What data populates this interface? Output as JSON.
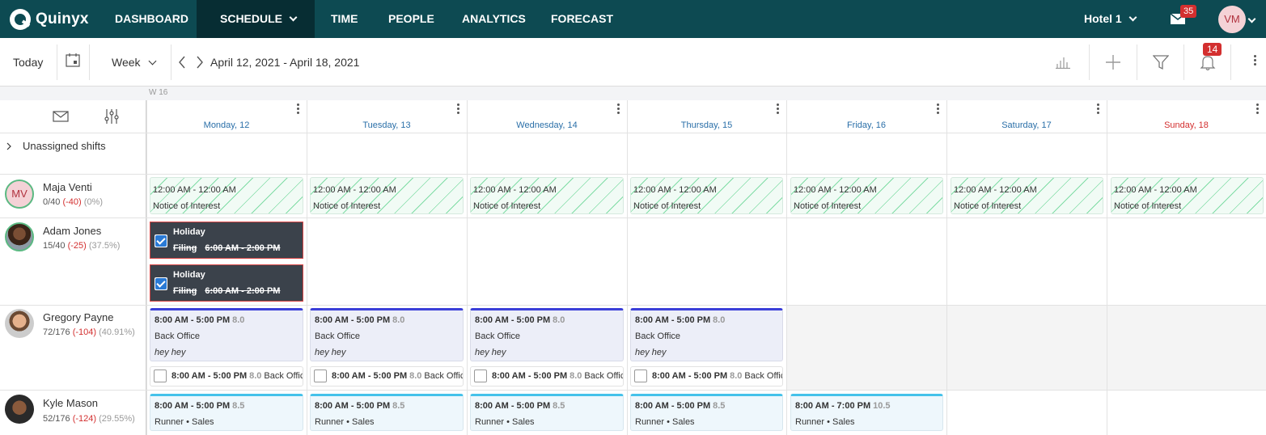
{
  "nav": {
    "logo_text": "Quinyx",
    "items": [
      "DASHBOARD",
      "SCHEDULE",
      "TIME",
      "PEOPLE",
      "ANALYTICS",
      "FORECAST"
    ],
    "active": "SCHEDULE",
    "unit_selector": "Hotel 1",
    "messages_badge": "35",
    "user_initials": "VM"
  },
  "toolbar": {
    "today_label": "Today",
    "view_label": "Week",
    "date_range": "April 12, 2021 - April 18, 2021",
    "notifications_badge": "14"
  },
  "grid": {
    "week_label": "W 16",
    "days": [
      {
        "label": "Monday, 12",
        "color": "#2a6fa8"
      },
      {
        "label": "Tuesday, 13",
        "color": "#2a6fa8"
      },
      {
        "label": "Wednesday, 14",
        "color": "#2a6fa8"
      },
      {
        "label": "Thursday, 15",
        "color": "#2a6fa8"
      },
      {
        "label": "Friday, 16",
        "color": "#2a6fa8"
      },
      {
        "label": "Saturday, 17",
        "color": "#2a6fa8"
      },
      {
        "label": "Sunday, 18",
        "color": "#d32f2f"
      }
    ],
    "unassigned_label": "Unassigned shifts"
  },
  "people": [
    {
      "name": "Maja Venti",
      "hours": "0/40",
      "diff": "(-40)",
      "pct": "(0%)",
      "initials": "MV"
    },
    {
      "name": "Adam Jones",
      "hours": "15/40",
      "diff": "(-25)",
      "pct": "(37.5%)"
    },
    {
      "name": "Gregory Payne",
      "hours": "72/176",
      "diff": "(-104)",
      "pct": "(40.91%)"
    },
    {
      "name": "Kyle Mason",
      "hours": "52/176",
      "diff": "(-124)",
      "pct": "(29.55%)"
    }
  ],
  "shifts": {
    "notice": {
      "time": "12:00 AM - 12:00 AM",
      "label": "Notice of Interest"
    },
    "holiday": {
      "title": "Holiday",
      "task": "Filing",
      "time": "6:00 AM - 2:00 PM"
    },
    "back_office": {
      "time": "8:00 AM - 5:00 PM",
      "hours": "8.0",
      "label": "Back Office",
      "note": "hey hey"
    },
    "back_office_mini": {
      "time": "8:00 AM - 5:00 PM",
      "hours": "8.0",
      "label": "Back Offic"
    },
    "runner": {
      "time": "8:00 AM - 5:00 PM",
      "hours": "8.5",
      "label": "Runner • Sales"
    },
    "runner_friday": {
      "time": "8:00 AM - 7:00 PM",
      "hours": "10.5",
      "label": "Runner • Sales"
    }
  }
}
